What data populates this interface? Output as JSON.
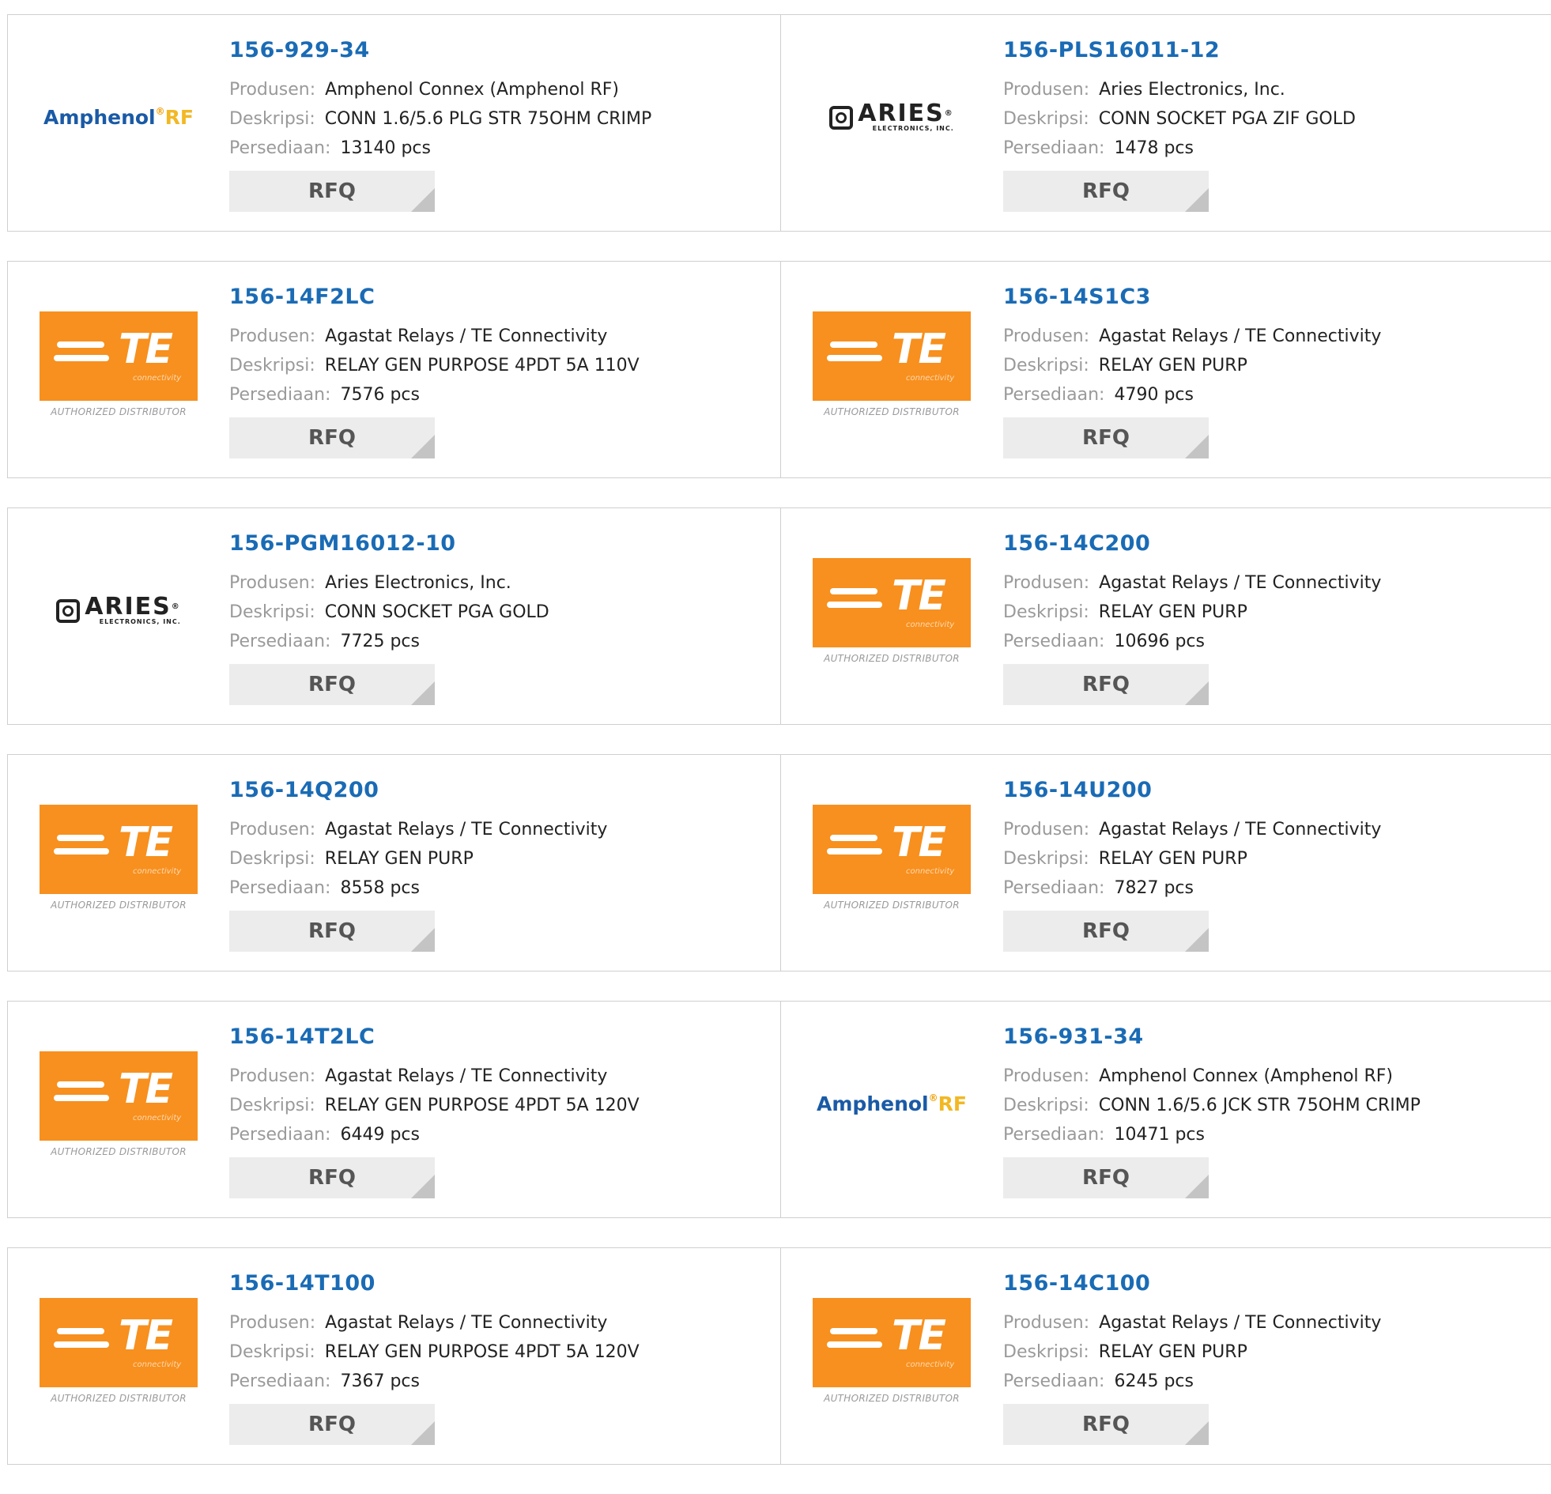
{
  "labels": {
    "manufacturer": "Produsen:",
    "description": "Deskripsi:",
    "stock": "Persediaan:",
    "rfq": "RFQ"
  },
  "logos": {
    "te": {
      "main": "TE",
      "sub": "connectivity",
      "auth": "AUTHORIZED DISTRIBUTOR",
      "color": "#f7901e"
    },
    "amphenol": {
      "word": "Amphenol",
      "reg": "®",
      "rf": "RF"
    },
    "aries": {
      "word": "ARIES",
      "reg": "®",
      "sub": "ELECTRONICS, INC."
    }
  },
  "products": [
    {
      "part": "156-929-34",
      "brand": "amphenol",
      "manufacturer": "Amphenol Connex (Amphenol RF)",
      "description": "CONN 1.6/5.6 PLG STR 75OHM CRIMP",
      "stock": "13140 pcs"
    },
    {
      "part": "156-PLS16011-12",
      "brand": "aries",
      "manufacturer": "Aries Electronics, Inc.",
      "description": "CONN SOCKET PGA ZIF GOLD",
      "stock": "1478 pcs"
    },
    {
      "part": "156-14F2LC",
      "brand": "te",
      "manufacturer": "Agastat Relays / TE Connectivity",
      "description": "RELAY GEN PURPOSE 4PDT 5A 110V",
      "stock": "7576 pcs"
    },
    {
      "part": "156-14S1C3",
      "brand": "te",
      "manufacturer": "Agastat Relays / TE Connectivity",
      "description": "RELAY GEN PURP",
      "stock": "4790 pcs"
    },
    {
      "part": "156-PGM16012-10",
      "brand": "aries",
      "manufacturer": "Aries Electronics, Inc.",
      "description": "CONN SOCKET PGA GOLD",
      "stock": "7725 pcs"
    },
    {
      "part": "156-14C200",
      "brand": "te",
      "manufacturer": "Agastat Relays / TE Connectivity",
      "description": "RELAY GEN PURP",
      "stock": "10696 pcs"
    },
    {
      "part": "156-14Q200",
      "brand": "te",
      "manufacturer": "Agastat Relays / TE Connectivity",
      "description": "RELAY GEN PURP",
      "stock": "8558 pcs"
    },
    {
      "part": "156-14U200",
      "brand": "te",
      "manufacturer": "Agastat Relays / TE Connectivity",
      "description": "RELAY GEN PURP",
      "stock": "7827 pcs"
    },
    {
      "part": "156-14T2LC",
      "brand": "te",
      "manufacturer": "Agastat Relays / TE Connectivity",
      "description": "RELAY GEN PURPOSE 4PDT 5A 120V",
      "stock": "6449 pcs"
    },
    {
      "part": "156-931-34",
      "brand": "amphenol",
      "manufacturer": "Amphenol Connex (Amphenol RF)",
      "description": "CONN 1.6/5.6 JCK STR 75OHM CRIMP",
      "stock": "10471 pcs"
    },
    {
      "part": "156-14T100",
      "brand": "te",
      "manufacturer": "Agastat Relays / TE Connectivity",
      "description": "RELAY GEN PURPOSE 4PDT 5A 120V",
      "stock": "7367 pcs"
    },
    {
      "part": "156-14C100",
      "brand": "te",
      "manufacturer": "Agastat Relays / TE Connectivity",
      "description": "RELAY GEN PURP",
      "stock": "6245 pcs"
    }
  ]
}
